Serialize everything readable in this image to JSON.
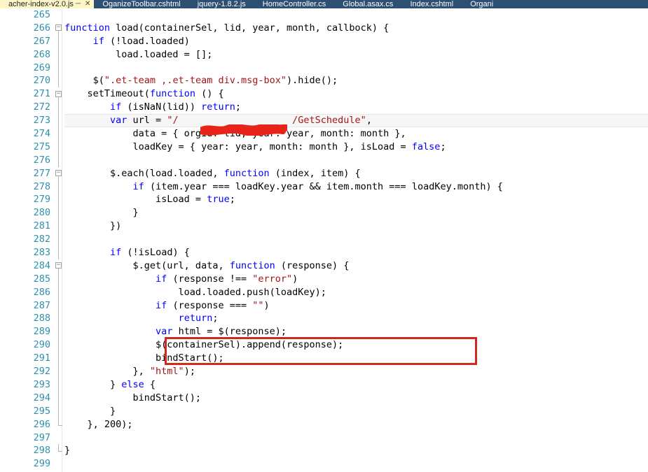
{
  "window": {
    "app": "Visual Studio Code Editor",
    "accent_color": "#2d4f72",
    "active_tab_color": "#fdf6c9",
    "annotation_color": "#d02a1e",
    "linenumber_color": "#2b91af",
    "keyword_color": "#0000ff",
    "string_color": "#a31515"
  },
  "tab_bar": {
    "tabs": [
      {
        "label": "acher-index-v2.0.js",
        "active": true,
        "pin_icon": "pin-icon",
        "close_icon": "close-icon"
      },
      {
        "label": "OganizeToolbar.cshtml",
        "active": false
      },
      {
        "label": "jquery-1.8.2.js",
        "active": false
      },
      {
        "label": "HomeController.cs",
        "active": false
      },
      {
        "label": "Global.asax.cs",
        "active": false
      },
      {
        "label": "Index.cshtml",
        "active": false
      },
      {
        "label": "Organi",
        "active": false
      }
    ]
  },
  "editor": {
    "current_line": 273,
    "lines": [
      {
        "no": "265",
        "fold": "",
        "guide": "",
        "tokens": []
      },
      {
        "no": "266",
        "fold": "minus",
        "guide": "",
        "tokens": [
          {
            "t": "function",
            "c": "kw"
          },
          {
            "t": " load(containerSel, lid, year, month, callbock) {",
            "c": "pln"
          }
        ]
      },
      {
        "no": "267",
        "fold": "",
        "guide": "full",
        "tokens": [
          {
            "t": "     ",
            "c": "pln"
          },
          {
            "t": "if",
            "c": "kw"
          },
          {
            "t": " (!load.loaded)",
            "c": "pln"
          }
        ]
      },
      {
        "no": "268",
        "fold": "",
        "guide": "full",
        "tokens": [
          {
            "t": "         load.loaded = [];",
            "c": "pln"
          }
        ]
      },
      {
        "no": "269",
        "fold": "",
        "guide": "full",
        "tokens": []
      },
      {
        "no": "270",
        "fold": "",
        "guide": "full",
        "tokens": [
          {
            "t": "     $(",
            "c": "pln"
          },
          {
            "t": "\".et-team ,.et-team div.msg-box\"",
            "c": "str"
          },
          {
            "t": ").hide();",
            "c": "pln"
          }
        ]
      },
      {
        "no": "271",
        "fold": "minus",
        "guide": "",
        "tokens": [
          {
            "t": "    setTimeout(",
            "c": "pln"
          },
          {
            "t": "function",
            "c": "kw"
          },
          {
            "t": " () {",
            "c": "pln"
          }
        ]
      },
      {
        "no": "272",
        "fold": "",
        "guide": "full",
        "tokens": [
          {
            "t": "        ",
            "c": "pln"
          },
          {
            "t": "if",
            "c": "kw"
          },
          {
            "t": " (isNaN(lid)) ",
            "c": "pln"
          },
          {
            "t": "return",
            "c": "kw"
          },
          {
            "t": ";",
            "c": "pln"
          }
        ]
      },
      {
        "no": "273",
        "fold": "",
        "guide": "full",
        "current": true,
        "tokens": [
          {
            "t": "        ",
            "c": "pln"
          },
          {
            "t": "var",
            "c": "kw"
          },
          {
            "t": " url = ",
            "c": "pln"
          },
          {
            "t": "\"/                    /GetSchedule\"",
            "c": "str"
          },
          {
            "t": ",",
            "c": "pln"
          }
        ]
      },
      {
        "no": "274",
        "fold": "",
        "guide": "full",
        "tokens": [
          {
            "t": "            data = { orgId: lid, year: year, month: month },",
            "c": "pln"
          }
        ]
      },
      {
        "no": "275",
        "fold": "",
        "guide": "full",
        "tokens": [
          {
            "t": "            loadKey = { year: year, month: month }, isLoad = ",
            "c": "pln"
          },
          {
            "t": "false",
            "c": "kw"
          },
          {
            "t": ";",
            "c": "pln"
          }
        ]
      },
      {
        "no": "276",
        "fold": "",
        "guide": "full",
        "tokens": []
      },
      {
        "no": "277",
        "fold": "minus",
        "guide": "",
        "tokens": [
          {
            "t": "        $.each(load.loaded, ",
            "c": "pln"
          },
          {
            "t": "function",
            "c": "kw"
          },
          {
            "t": " (index, item) {",
            "c": "pln"
          }
        ]
      },
      {
        "no": "278",
        "fold": "",
        "guide": "full",
        "tokens": [
          {
            "t": "            ",
            "c": "pln"
          },
          {
            "t": "if",
            "c": "kw"
          },
          {
            "t": " (item.year === loadKey.year && item.month === loadKey.month) {",
            "c": "pln"
          }
        ]
      },
      {
        "no": "279",
        "fold": "",
        "guide": "full",
        "tokens": [
          {
            "t": "                isLoad = ",
            "c": "pln"
          },
          {
            "t": "true",
            "c": "kw"
          },
          {
            "t": ";",
            "c": "pln"
          }
        ]
      },
      {
        "no": "280",
        "fold": "",
        "guide": "full",
        "tokens": [
          {
            "t": "            }",
            "c": "pln"
          }
        ]
      },
      {
        "no": "281",
        "fold": "",
        "guide": "full",
        "tokens": [
          {
            "t": "        })",
            "c": "pln"
          }
        ]
      },
      {
        "no": "282",
        "fold": "",
        "guide": "full",
        "tokens": []
      },
      {
        "no": "283",
        "fold": "",
        "guide": "full",
        "tokens": [
          {
            "t": "        ",
            "c": "pln"
          },
          {
            "t": "if",
            "c": "kw"
          },
          {
            "t": " (!isLoad) {",
            "c": "pln"
          }
        ]
      },
      {
        "no": "284",
        "fold": "minus",
        "guide": "",
        "tokens": [
          {
            "t": "            $.get(url, data, ",
            "c": "pln"
          },
          {
            "t": "function",
            "c": "kw"
          },
          {
            "t": " (response) {",
            "c": "pln"
          }
        ]
      },
      {
        "no": "285",
        "fold": "",
        "guide": "full",
        "tokens": [
          {
            "t": "                ",
            "c": "pln"
          },
          {
            "t": "if",
            "c": "kw"
          },
          {
            "t": " (response !== ",
            "c": "pln"
          },
          {
            "t": "\"error\"",
            "c": "str"
          },
          {
            "t": ")",
            "c": "pln"
          }
        ]
      },
      {
        "no": "286",
        "fold": "",
        "guide": "full",
        "tokens": [
          {
            "t": "                    load.loaded.push(loadKey);",
            "c": "pln"
          }
        ]
      },
      {
        "no": "287",
        "fold": "",
        "guide": "full",
        "tokens": [
          {
            "t": "                ",
            "c": "pln"
          },
          {
            "t": "if",
            "c": "kw"
          },
          {
            "t": " (response === ",
            "c": "pln"
          },
          {
            "t": "\"\"",
            "c": "str"
          },
          {
            "t": ")",
            "c": "pln"
          }
        ]
      },
      {
        "no": "288",
        "fold": "",
        "guide": "full",
        "tokens": [
          {
            "t": "                    ",
            "c": "pln"
          },
          {
            "t": "return",
            "c": "kw"
          },
          {
            "t": ";",
            "c": "pln"
          }
        ]
      },
      {
        "no": "289",
        "fold": "",
        "guide": "full",
        "tokens": [
          {
            "t": "                ",
            "c": "pln"
          },
          {
            "t": "var",
            "c": "kw"
          },
          {
            "t": " html = $(response);",
            "c": "pln"
          }
        ]
      },
      {
        "no": "290",
        "fold": "",
        "guide": "full",
        "tokens": [
          {
            "t": "                $(containerSel).append(response);",
            "c": "pln"
          }
        ]
      },
      {
        "no": "291",
        "fold": "",
        "guide": "full",
        "tokens": [
          {
            "t": "                bindStart();",
            "c": "pln"
          }
        ]
      },
      {
        "no": "292",
        "fold": "",
        "guide": "full",
        "tokens": [
          {
            "t": "            }, ",
            "c": "pln"
          },
          {
            "t": "\"html\"",
            "c": "str"
          },
          {
            "t": ");",
            "c": "pln"
          }
        ]
      },
      {
        "no": "293",
        "fold": "",
        "guide": "full",
        "tokens": [
          {
            "t": "        } ",
            "c": "pln"
          },
          {
            "t": "else",
            "c": "kw"
          },
          {
            "t": " {",
            "c": "pln"
          }
        ]
      },
      {
        "no": "294",
        "fold": "",
        "guide": "full",
        "tokens": [
          {
            "t": "            bindStart();",
            "c": "pln"
          }
        ]
      },
      {
        "no": "295",
        "fold": "",
        "guide": "full",
        "tokens": [
          {
            "t": "        }",
            "c": "pln"
          }
        ]
      },
      {
        "no": "296",
        "fold": "",
        "guide": "end",
        "tokens": [
          {
            "t": "    }, ",
            "c": "pln"
          },
          {
            "t": "200",
            "c": "num"
          },
          {
            "t": ");",
            "c": "pln"
          }
        ]
      },
      {
        "no": "297",
        "fold": "",
        "guide": "",
        "tokens": []
      },
      {
        "no": "298",
        "fold": "",
        "guide": "endall",
        "tokens": [
          {
            "t": "}",
            "c": "pln"
          }
        ]
      },
      {
        "no": "299",
        "fold": "",
        "guide": "",
        "tokens": []
      }
    ]
  },
  "annotations": {
    "redaction": {
      "name": "red-scribble-redaction",
      "target_line": "273",
      "covers": "url path segment"
    },
    "highlight_box": {
      "name": "red-rectangle-highlight",
      "lines": [
        "289",
        "290"
      ]
    }
  }
}
